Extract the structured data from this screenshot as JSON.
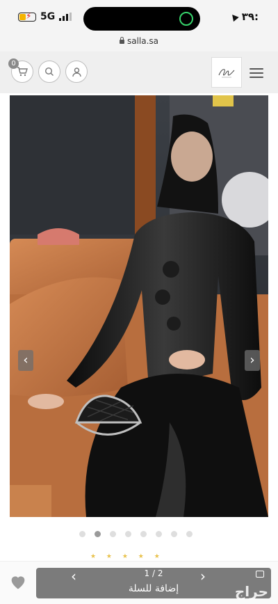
{
  "status_bar": {
    "network": "5G",
    "time": "٣٩:"
  },
  "url_bar": {
    "domain": "salla.sa"
  },
  "header": {
    "cart_count": "0"
  },
  "slider": {
    "dot_count": 8,
    "active_index": 1
  },
  "bottom": {
    "add_to_cart_label": "إضافة للسلة",
    "image_counter": "1 / 2",
    "watermark": "حراج"
  },
  "colors": {
    "button": "#7b7b7b",
    "dot_active": "#9a9a9a",
    "dot_inactive": "#dedede"
  }
}
